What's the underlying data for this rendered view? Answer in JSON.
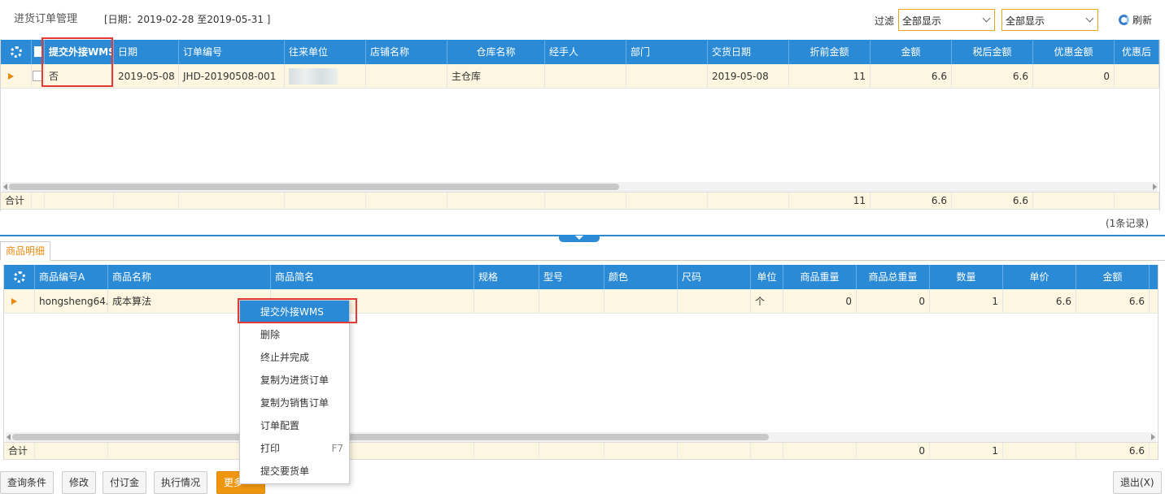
{
  "header": {
    "title": "进货订单管理",
    "date_range": "[日期：2019-02-28  至2019-05-31  ]",
    "filter_label": "过滤",
    "filter1": "全部显示",
    "filter2": "全部显示",
    "refresh_label": "刷新"
  },
  "orders": {
    "columns": [
      "提交外接WMS",
      "日期",
      "订单编号",
      "往来单位",
      "店铺名称",
      "仓库名称",
      "经手人",
      "部门",
      "交货日期",
      "折前金额",
      "金额",
      "税后金额",
      "优惠金额",
      "优惠后"
    ],
    "row": {
      "wms": "否",
      "date": "2019-05-08",
      "order_no": "JHD-20190508-001",
      "partner": "",
      "shop": "",
      "warehouse": "主仓库",
      "handler": "",
      "dept": "",
      "delivery_date": "2019-05-08",
      "pre_discount": "11",
      "amount": "6.6",
      "after_tax": "6.6",
      "discount": "0",
      "after_discount": ""
    },
    "summary": {
      "label": "合计",
      "pre_discount": "11",
      "amount": "6.6",
      "after_tax": "6.6"
    },
    "record_count": "(1条记录)"
  },
  "detail_tab": "商品明细",
  "items": {
    "columns": [
      "商品编号A",
      "商品名称",
      "商品简名",
      "规格",
      "型号",
      "颜色",
      "尺码",
      "单位",
      "商品重量",
      "商品总重量",
      "数量",
      "单价",
      "金额"
    ],
    "row": {
      "code": "hongsheng64...",
      "name": "成本算法",
      "short": "",
      "spec": "",
      "model": "",
      "color": "",
      "size": "",
      "unit": "个",
      "weight": "0",
      "total_weight": "0",
      "qty": "1",
      "price": "6.6",
      "amount": "6.6"
    },
    "summary": {
      "label": "合计",
      "total_weight": "0",
      "qty": "1",
      "amount": "6.6"
    }
  },
  "context_menu": [
    {
      "label": "提交外接WMS",
      "shortcut": ""
    },
    {
      "label": "删除",
      "shortcut": ""
    },
    {
      "label": "终止并完成",
      "shortcut": ""
    },
    {
      "label": "复制为进货订单",
      "shortcut": ""
    },
    {
      "label": "复制为销售订单",
      "shortcut": ""
    },
    {
      "label": "订单配置",
      "shortcut": ""
    },
    {
      "label": "打印",
      "shortcut": "F7"
    },
    {
      "label": "提交要货单",
      "shortcut": ""
    }
  ],
  "buttons": {
    "query": "查询条件",
    "edit": "修改",
    "deposit": "付订金",
    "status": "执行情况",
    "more": "更多",
    "exit": "退出(X)"
  },
  "colors": {
    "header_blue": "#2b8ad6",
    "accent_orange": "#f0960e",
    "highlight_red": "#e53935",
    "row_bg": "#fdf6e0"
  }
}
